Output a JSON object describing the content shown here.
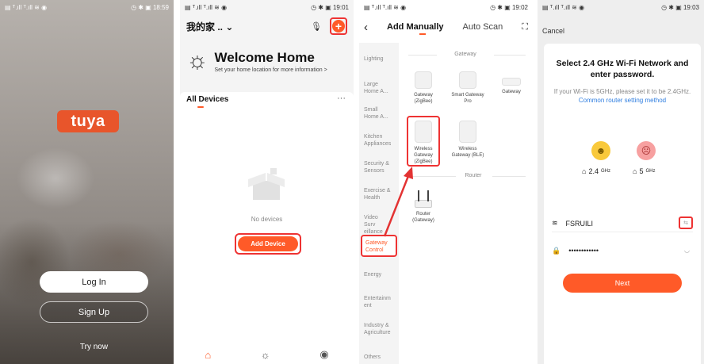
{
  "screen1": {
    "status_left": "▤ ᵀ.ıll ᵀ.ıll ≋ ◉",
    "status_right": "◷ ✱ ▣ 18:59",
    "logo_text": "tuya",
    "login_label": "Log In",
    "signup_label": "Sign Up",
    "try_label": "Try now"
  },
  "screen2": {
    "status_left": "▤ ᵀ.ıll ᵀ.ıll ≋ ◉",
    "status_right": "◷ ✱ ▣ 19:01",
    "home_name": "我的家 .. ⌄",
    "welcome_title": "Welcome Home",
    "welcome_sub": "Set your home location for more information >",
    "all_devices": "All Devices",
    "more": "···",
    "no_devices": "No devices",
    "add_device": "Add Device"
  },
  "screen3": {
    "status_left": "▤ ᵀ.ıll ᵀ.ıll ≋ ◉",
    "status_right": "◷ ✱ ▣ 19:02",
    "tab_manual": "Add Manually",
    "tab_scan": "Auto Scan",
    "categories": [
      "Lighting",
      "Large Home A...",
      "Small Home A...",
      "Kitchen Appliances",
      "Security & Sensors",
      "Exercise & Health",
      "Video Surv eillance",
      "Gateway Control",
      "Energy",
      "Entertainm ent",
      "Industry & Agriculture",
      "Others"
    ],
    "section_gateway": "Gateway",
    "section_router": "Router",
    "devices": {
      "gw_zigbee": "Gateway (ZigBee)",
      "smart_pro": "Smart Gateway Pro",
      "gateway": "Gateway",
      "wireless_zigbee": "Wireless Gateway (ZigBee)",
      "wireless_ble": "Wireless Gateway (BLE)",
      "router": "Router (Gateway)"
    }
  },
  "screen4": {
    "status_left": "▤ ᵀ.ıll ᵀ.ıll ≋ ◉",
    "status_right": "◷ ✱ ▣ 19:03",
    "cancel": "Cancel",
    "title": "Select 2.4 GHz Wi-Fi Network and enter password.",
    "desc": "If your Wi-Fi is 5GHz, please set it to be 2.4GHz.",
    "desc_link": "Common router setting method",
    "band24": "2.4",
    "band24_unit": "GHz",
    "band5": "5",
    "band5_unit": "GHz",
    "ssid": "FSRUILI",
    "password_mask": "••••••••••••",
    "next": "Next"
  },
  "colors": {
    "accent": "#ff5a28",
    "highlight": "#e33333",
    "link": "#2f7ee0"
  }
}
